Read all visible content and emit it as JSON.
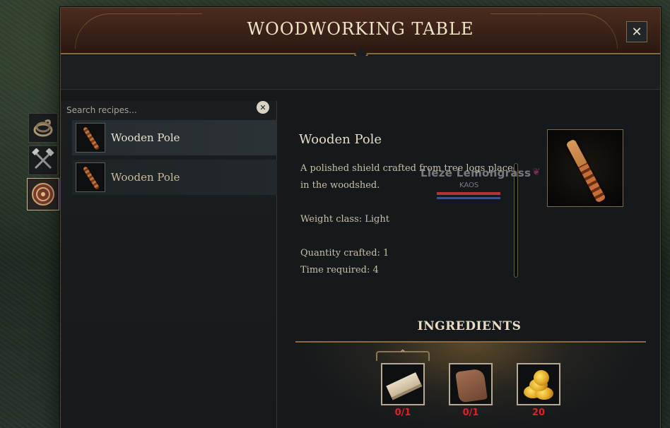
{
  "window": {
    "title": "WOODWORKING TABLE",
    "close_label": "✕"
  },
  "search": {
    "placeholder": "Search recipes...",
    "value": "",
    "clear_label": "✕"
  },
  "side_tabs": [
    {
      "icon": "rope-coil-icon",
      "active": false
    },
    {
      "icon": "crossed-tools-icon",
      "active": false
    },
    {
      "icon": "round-shield-icon",
      "active": true
    }
  ],
  "recipes": [
    {
      "label": "Wooden Pole",
      "icon": "wooden-pole-icon",
      "selected": true
    },
    {
      "label": "Wooden Pole",
      "icon": "wooden-pole-icon",
      "selected": false
    }
  ],
  "detail": {
    "title": "Wooden Pole",
    "description_line1": "A polished shield crafted from tree logs placed",
    "description_line2": "in the woodshed.",
    "weight_class": "Weight class: Light",
    "quantity": "Quantity crafted: 1",
    "time": "Time required: 4"
  },
  "ingredients": {
    "header": "INGREDIENTS",
    "items": [
      {
        "icon": "wood-plank-icon",
        "count": "0/1"
      },
      {
        "icon": "leather-hide-icon",
        "count": "0/1"
      },
      {
        "icon": "gold-coins-icon",
        "count": "20"
      }
    ]
  },
  "nameplate": {
    "name": "Lieze Lemongrass",
    "guild": "KAOS",
    "icon": "heart-icon"
  },
  "colors": {
    "accent_gold": "#8a6a3b",
    "missing_red": "#d8242a",
    "titlebar_brown": "#3a2117"
  }
}
